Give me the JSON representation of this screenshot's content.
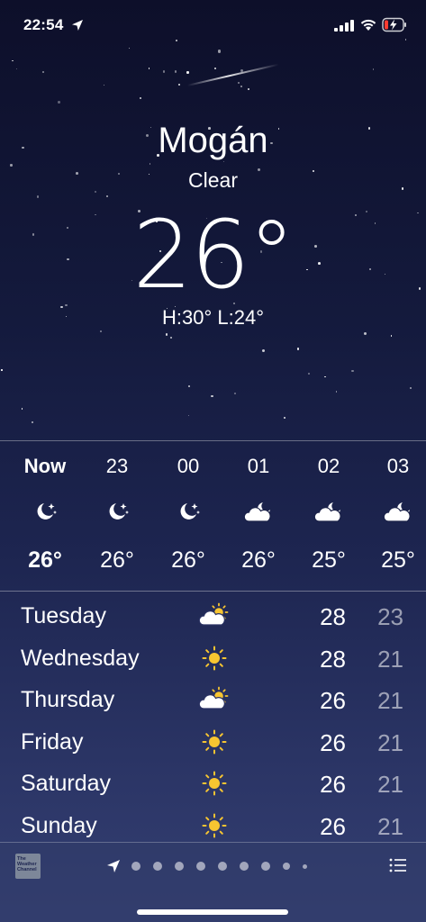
{
  "status_bar": {
    "time": "22:54",
    "icons": [
      "location-arrow-icon",
      "cellular-signal-icon",
      "wifi-icon",
      "battery-charging-icon"
    ],
    "battery_color": "#ff3b30"
  },
  "location": {
    "city": "Mogán",
    "condition": "Clear",
    "temperature": "26°",
    "high_low": "H:30°  L:24°"
  },
  "hourly": [
    {
      "time": "Now",
      "icon": "moon-stars-icon",
      "temp": "26°"
    },
    {
      "time": "23",
      "icon": "moon-stars-icon",
      "temp": "26°"
    },
    {
      "time": "00",
      "icon": "moon-stars-icon",
      "temp": "26°"
    },
    {
      "time": "01",
      "icon": "cloud-moon-icon",
      "temp": "26°"
    },
    {
      "time": "02",
      "icon": "cloud-moon-icon",
      "temp": "25°"
    },
    {
      "time": "03",
      "icon": "cloud-moon-icon",
      "temp": "25°"
    }
  ],
  "daily": [
    {
      "day": "Tuesday",
      "icon": "cloud-sun-icon",
      "high": "28",
      "low": "23"
    },
    {
      "day": "Wednesday",
      "icon": "sun-icon",
      "high": "28",
      "low": "21"
    },
    {
      "day": "Thursday",
      "icon": "cloud-sun-icon",
      "high": "26",
      "low": "21"
    },
    {
      "day": "Friday",
      "icon": "sun-icon",
      "high": "26",
      "low": "21"
    },
    {
      "day": "Saturday",
      "icon": "sun-icon",
      "high": "26",
      "low": "21"
    },
    {
      "day": "Sunday",
      "icon": "sun-icon",
      "high": "26",
      "low": "21"
    }
  ],
  "bottom_bar": {
    "provider_logo_text": "The Weather Channel",
    "page_count": 9,
    "current_page": "location",
    "icons": [
      "weather-channel-logo-icon",
      "location-arrow-icon",
      "list-icon"
    ]
  },
  "colors": {
    "sun": "#f7c531",
    "background_top": "#0d0f2a",
    "background_bottom": "#343f72"
  }
}
